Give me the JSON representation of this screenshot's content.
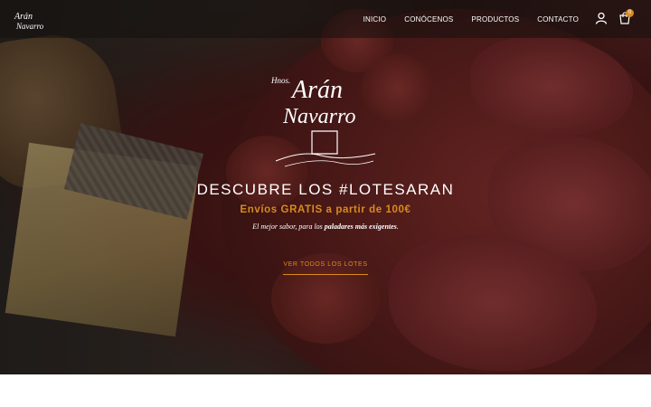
{
  "nav": {
    "logo_alt": "Hermanos Arán Navarro",
    "items": [
      {
        "label": "INICIO"
      },
      {
        "label": "CONÓCENOS"
      },
      {
        "label": "PRODUCTOS"
      },
      {
        "label": "CONTACTO"
      }
    ],
    "cart_count": "0"
  },
  "hero": {
    "logo_text_top": "Hnos.",
    "logo_text_1": "Arán",
    "logo_text_2": "Navarro",
    "headline": "DESCUBRE LOS #LOTESARAN",
    "subline": "Envíos GRATIS a partir de 100€",
    "tagline_part1": "El mejor sabor, para los ",
    "tagline_bold": "paladares más exigentes",
    "tagline_end": ".",
    "cta_label": "VER TODOS LOS LOTES"
  },
  "colors": {
    "accent": "#d98b1f",
    "nav_bg": "#14100e",
    "text_light": "#ffffff"
  }
}
